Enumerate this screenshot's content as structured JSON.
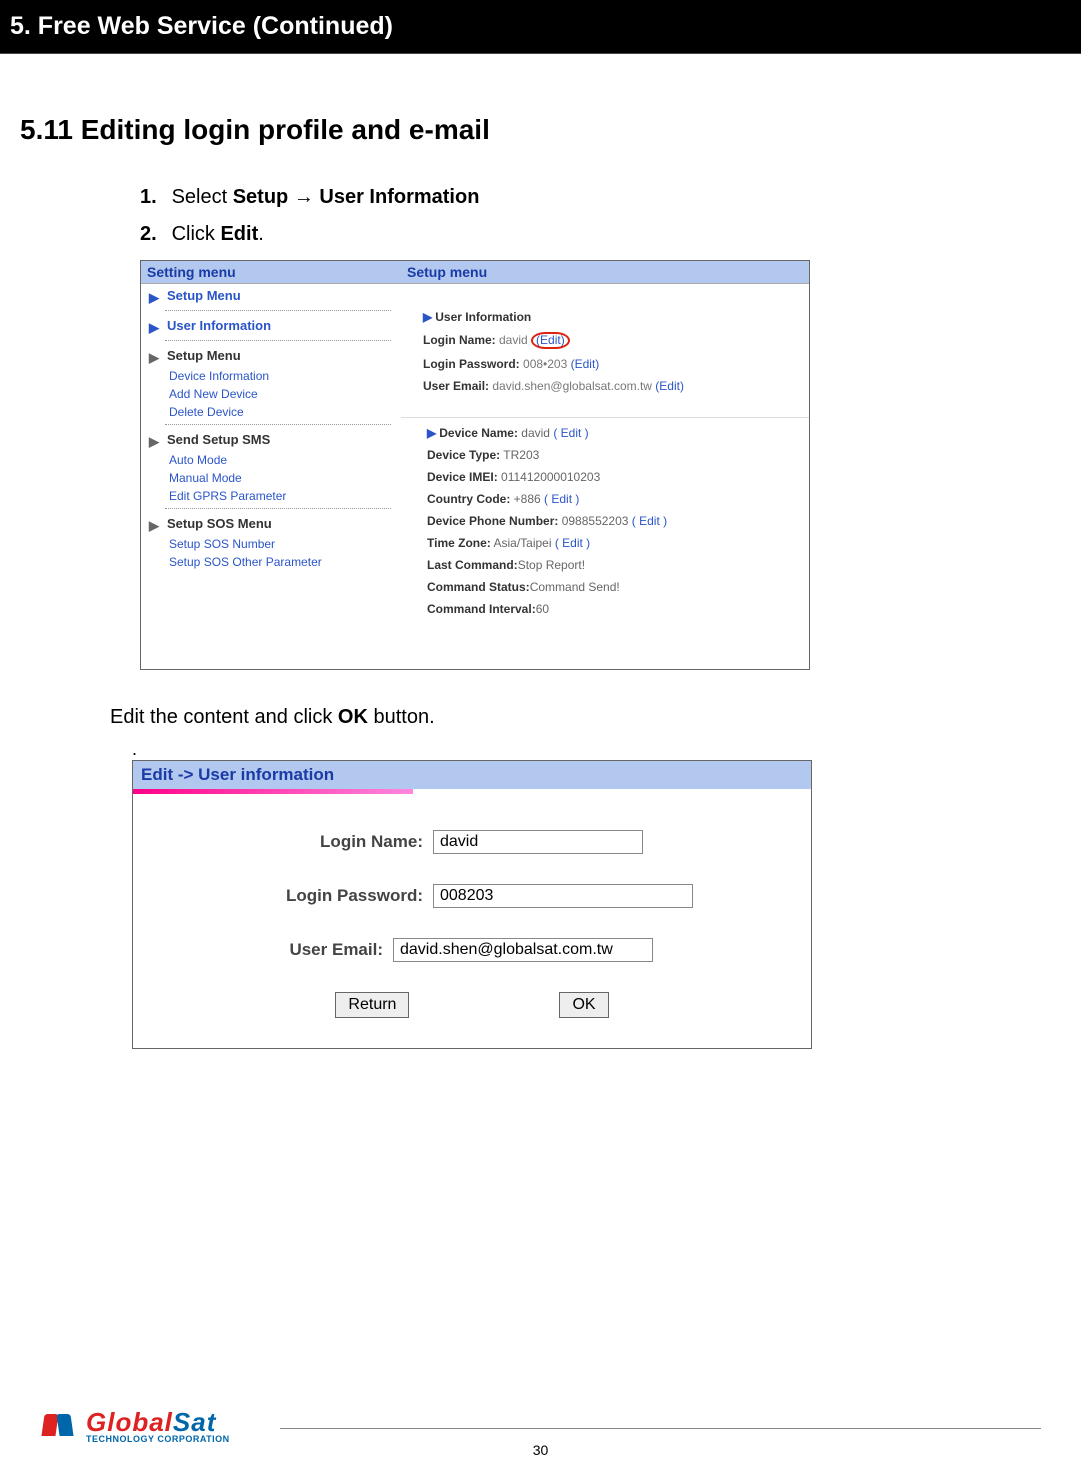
{
  "chapter": "5. Free Web Service (Continued)",
  "section_title": "5.11 Editing login profile and e-mail",
  "steps": {
    "s1_num": "1.",
    "s1_pre": "Select ",
    "s1_b1": "Setup ",
    "s1_arrow": "→",
    "s1_b2": " User Information",
    "s2_num": "2.",
    "s2_pre": "Click ",
    "s2_b1": "Edit",
    "s2_post": "."
  },
  "shot1": {
    "left_header": "Setting menu",
    "right_header": "Setup menu",
    "menu": {
      "setup_menu": "Setup Menu",
      "user_info": "User Information",
      "setup_menu2": "Setup Menu",
      "dev_info": "Device Information",
      "add_dev": "Add New Device",
      "del_dev": "Delete Device",
      "send_sms": "Send Setup SMS",
      "auto_mode": "Auto Mode",
      "manual_mode": "Manual Mode",
      "edit_gprs": "Edit GPRS Parameter",
      "sos_menu": "Setup SOS Menu",
      "sos_num": "Setup SOS Number",
      "sos_other": "Setup SOS Other Parameter"
    },
    "info": {
      "hdr": "User Information",
      "login_name_lbl": "Login Name:",
      "login_name_val": " david ",
      "login_pw_lbl": "Login Password:",
      "login_pw_val": " 008•203   ",
      "email_lbl": "User Email:",
      "email_val": " david.shen@globalsat.com.tw    ",
      "edit_txt": "(Edit)",
      "dev_name_lbl": "Device Name:",
      "dev_name_val": " david    ",
      "edit_paren": "( Edit )",
      "dev_type_lbl": "Device Type:",
      "dev_type_val": " TR203",
      "imei_lbl": "Device IMEI:",
      "imei_val": " 011412000010203",
      "cc_lbl": "Country Code:",
      "cc_val": " +886 ",
      "phone_lbl": "Device Phone Number:",
      "phone_val": " 0988552203 ",
      "tz_lbl": "Time Zone:",
      "tz_val": " Asia/Taipei ",
      "last_cmd_lbl": "Last Command:",
      "last_cmd_val": "Stop Report!",
      "cmd_status_lbl": "Command Status:",
      "cmd_status_val": "Command Send!",
      "cmd_int_lbl": "Command Interval:",
      "cmd_int_val": "60"
    }
  },
  "mid_pre": "Edit the content and click ",
  "mid_b": "OK",
  "mid_post": " button.",
  "shot2": {
    "hdr": "Edit -> User information",
    "login_name_lbl": "Login Name:",
    "login_name_val": "david",
    "login_pw_lbl": "Login Password:",
    "login_pw_val": "008203",
    "email_lbl": "User Email:",
    "email_val": "david.shen@globalsat.com.tw",
    "return_btn": "Return",
    "ok_btn": "OK"
  },
  "footer": {
    "brand1": "Global",
    "brand2": "Sat",
    "tag": "TECHNOLOGY CORPORATION",
    "page_num": "30"
  }
}
